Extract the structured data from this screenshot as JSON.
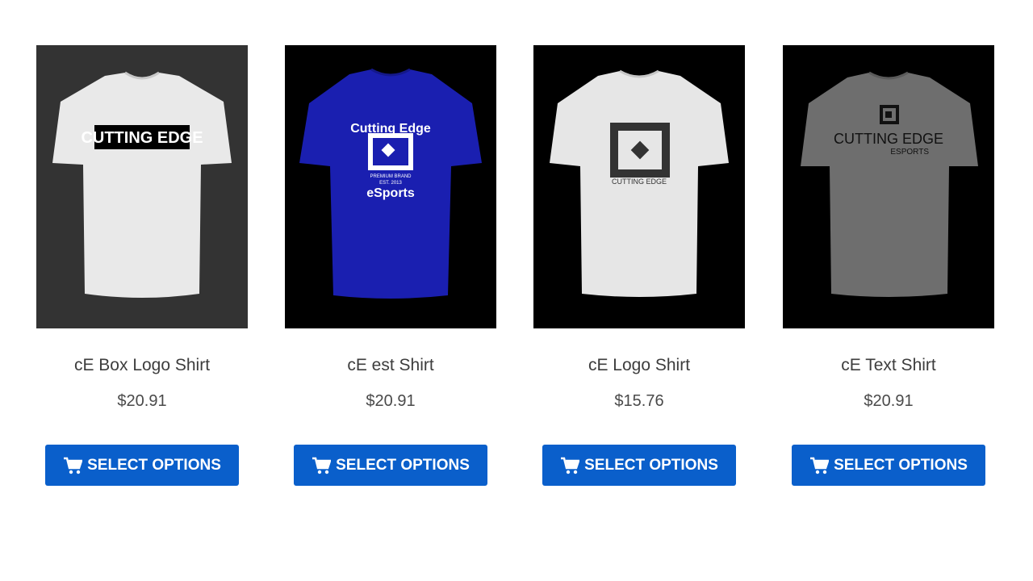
{
  "products": [
    {
      "title": "cE Box Logo Shirt",
      "price": "$20.91",
      "button_label": "SELECT OPTIONS",
      "background": "#333333",
      "shirt_color": "#e9e9e9",
      "image_text": "CUTTING EDGE"
    },
    {
      "title": "cE est Shirt",
      "price": "$20.91",
      "button_label": "SELECT OPTIONS",
      "background": "#000000",
      "shirt_color": "#1a1fb0",
      "image_text": "Cutting Edge",
      "image_text_2": "eSports",
      "image_text_3": "PREMIUM BRAND",
      "image_text_4": "EST. 2013"
    },
    {
      "title": "cE Logo Shirt",
      "price": "$15.76",
      "button_label": "SELECT OPTIONS",
      "background": "#000000",
      "shirt_color": "#e6e6e6",
      "image_text": "CUTTING EDGE"
    },
    {
      "title": "cE Text Shirt",
      "price": "$20.91",
      "button_label": "SELECT OPTIONS",
      "background": "#000000",
      "shirt_color": "#6e6e6e",
      "image_text": "CUTTING EDGE",
      "image_text_2": "ESPORTS"
    }
  ],
  "accent_color": "#0a5fcb",
  "button_icon": "cart-icon"
}
